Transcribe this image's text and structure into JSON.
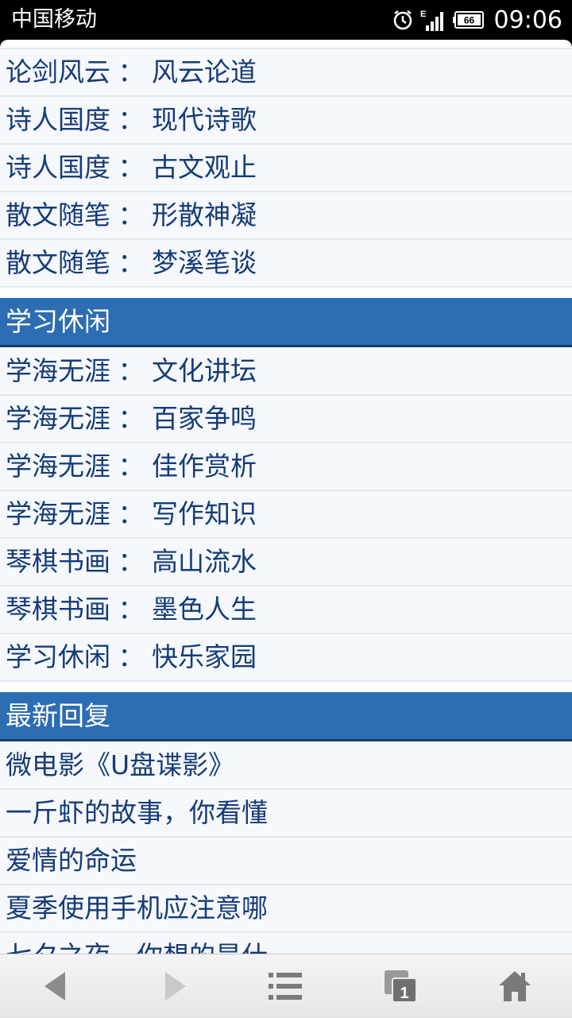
{
  "status_bar": {
    "carrier": "中国移动",
    "time": "09:06",
    "battery": "66",
    "network": "E"
  },
  "sections": [
    {
      "rows": [
        {
          "category": "论剑风云",
          "sep": "：",
          "forum": "风云论道"
        },
        {
          "category": "诗人国度",
          "sep": "：",
          "forum": "现代诗歌"
        },
        {
          "category": "诗人国度",
          "sep": "：",
          "forum": "古文观止"
        },
        {
          "category": "散文随笔",
          "sep": "：",
          "forum": "形散神凝"
        },
        {
          "category": "散文随笔",
          "sep": "：",
          "forum": "梦溪笔谈"
        }
      ]
    },
    {
      "title": "学习休闲",
      "rows": [
        {
          "category": "学海无涯",
          "sep": "：",
          "forum": "文化讲坛"
        },
        {
          "category": "学海无涯",
          "sep": "：",
          "forum": "百家争鸣"
        },
        {
          "category": "学海无涯",
          "sep": "：",
          "forum": "佳作赏析"
        },
        {
          "category": "学海无涯",
          "sep": "：",
          "forum": "写作知识"
        },
        {
          "category": "琴棋书画",
          "sep": "：",
          "forum": "高山流水"
        },
        {
          "category": "琴棋书画",
          "sep": "：",
          "forum": "墨色人生"
        },
        {
          "category": "学习休闲",
          "sep": "：",
          "forum": "快乐家园"
        }
      ]
    },
    {
      "title": "最新回复",
      "rows": [
        {
          "text": "微电影《U盘谍影》"
        },
        {
          "text": "一斤虾的故事，你看懂"
        },
        {
          "text": "爱情的命运"
        },
        {
          "text": "夏季使用手机应注意哪"
        },
        {
          "text": "七夕之夜，你想的是什"
        }
      ]
    }
  ],
  "navbar": {
    "tabs_count": "1",
    "icons": [
      "back-arrow-icon",
      "forward-arrow-icon",
      "menu-list-icon",
      "tabs-icon",
      "home-icon"
    ]
  }
}
